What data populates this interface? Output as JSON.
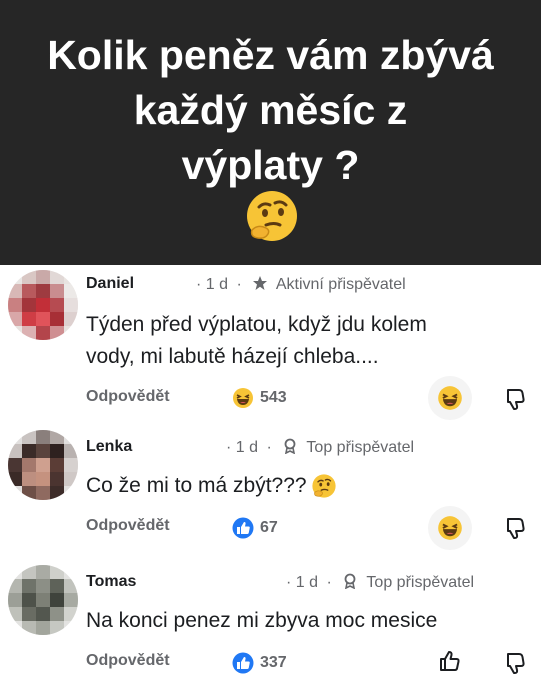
{
  "banner": {
    "title_lines": [
      "Kolik peněz vám zbývá",
      "každý měsíc z",
      "výplaty ?"
    ],
    "emoji": "thinking-face"
  },
  "colors": {
    "banner_bg": "#262626",
    "text": "#1c1e21",
    "muted": "#65676b",
    "like_blue": "#2078f4",
    "emoji_yellow": "#f7c436"
  },
  "comments": [
    {
      "author": "Daniel",
      "time": "1 d",
      "separator": "·",
      "badge_icon": "star-icon",
      "badge": "Aktivní přispěvatel",
      "text_lines": [
        "Týden před výplatou, když jdu kolem",
        "vody, mi labutě házejí chleba...."
      ],
      "reply_label": "Odpovědět",
      "reaction_icon": "laughing-emoji-icon",
      "reaction_count": "543"
    },
    {
      "author": "Lenka",
      "time": "1 d",
      "separator": "·",
      "badge_icon": "top-contributor-icon",
      "badge": "Top přispěvatel",
      "text_lines": [
        "Co že mi to má zbýt???"
      ],
      "reply_label": "Odpovědět",
      "reaction_icon": "like-icon",
      "reaction_count": "67"
    },
    {
      "author": "Tomas",
      "time": "1 d",
      "separator": "·",
      "badge_icon": "top-contributor-icon",
      "badge": "Top přispěvatel",
      "text_lines": [
        "Na konci penez mi zbyva moc mesice"
      ],
      "reply_label": "Odpovědět",
      "reaction_icon": "like-icon",
      "reaction_count": "337"
    }
  ]
}
